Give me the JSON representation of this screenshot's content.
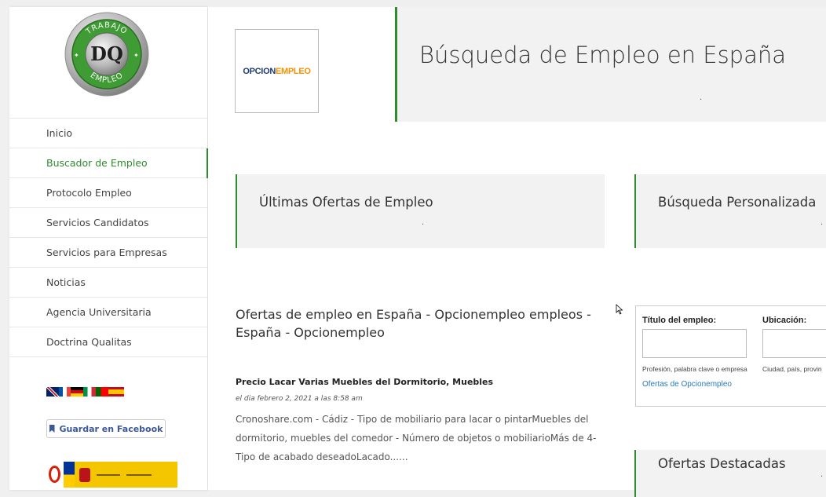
{
  "sidebar": {
    "logo": {
      "top_text": "TRABAJO",
      "center_text": "DQ",
      "bottom_text": "EMPLEO"
    },
    "nav": [
      {
        "label": "Inicio",
        "active": false
      },
      {
        "label": "Buscador de Empleo",
        "active": true
      },
      {
        "label": "Protocolo Empleo",
        "active": false
      },
      {
        "label": "Servicios Candidatos",
        "active": false
      },
      {
        "label": "Servicios para Empresas",
        "active": false
      },
      {
        "label": "Noticias",
        "active": false
      },
      {
        "label": "Agencia Universitaria",
        "active": false
      },
      {
        "label": "Doctrina Qualitas",
        "active": false
      }
    ],
    "facebook_button": "Guardar en Facebook"
  },
  "header": {
    "logo_part1": "OPCION",
    "logo_part2": "EMPLEO",
    "title": "Búsqueda de Empleo en España",
    "dot": "."
  },
  "sections": {
    "latest": {
      "title": "Últimas Ofertas de Empleo",
      "dot": "."
    },
    "custom": {
      "title": "Búsqueda Personalizada",
      "dot": "."
    },
    "featured": {
      "title": "Ofertas Destacadas",
      "dot": "."
    }
  },
  "offers": {
    "heading": "Ofertas de empleo en España - Opcionempleo empleos - España - Opcionempleo",
    "items": [
      {
        "title": "Precio Lacar Varias Muebles del Dormitorio, Muebles",
        "date": "el dia febrero 2, 2021 a las 8:58 am",
        "description": "Cronoshare.com - Cádiz - Tipo de mobiliario para lacar o pintarMuebles del dormitorio, muebles del comedor - Número de objetos o mobiliarioMás de 4- Tipo de acabado deseadoLacado......"
      }
    ]
  },
  "search_form": {
    "title_label": "Título del empleo:",
    "location_label": "Ubicación:",
    "title_value": "",
    "location_value": "",
    "title_hint": "Profesión, palabra clave o empresa",
    "location_hint": "Ciudad, país, provin",
    "link": "Ofertas de Opcionempleo"
  },
  "colors": {
    "accent": "#2e8b2e",
    "link": "#2a7ab8",
    "facebook": "#3b5998"
  }
}
